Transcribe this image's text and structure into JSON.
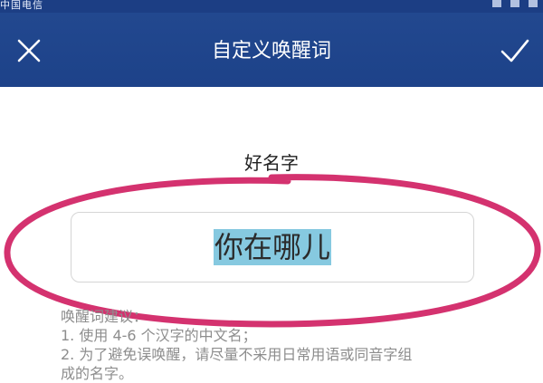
{
  "status_bar": {
    "carrier": "中国电信"
  },
  "header": {
    "title": "自定义唤醒词",
    "close_icon": "close-icon",
    "confirm_icon": "checkmark-icon"
  },
  "form": {
    "label": "好名字",
    "value": "你在哪儿"
  },
  "tips": {
    "heading": "唤醒词建议：",
    "items": [
      "1. 使用 4-6 个汉字的中文名；",
      "2. 为了避免误唤醒，请尽量不采用日常用语或同音字组",
      "成的名字。"
    ]
  },
  "colors": {
    "header_bg": "#1d4289",
    "highlight": "#86c9e0",
    "annotation": "#d4326f"
  }
}
